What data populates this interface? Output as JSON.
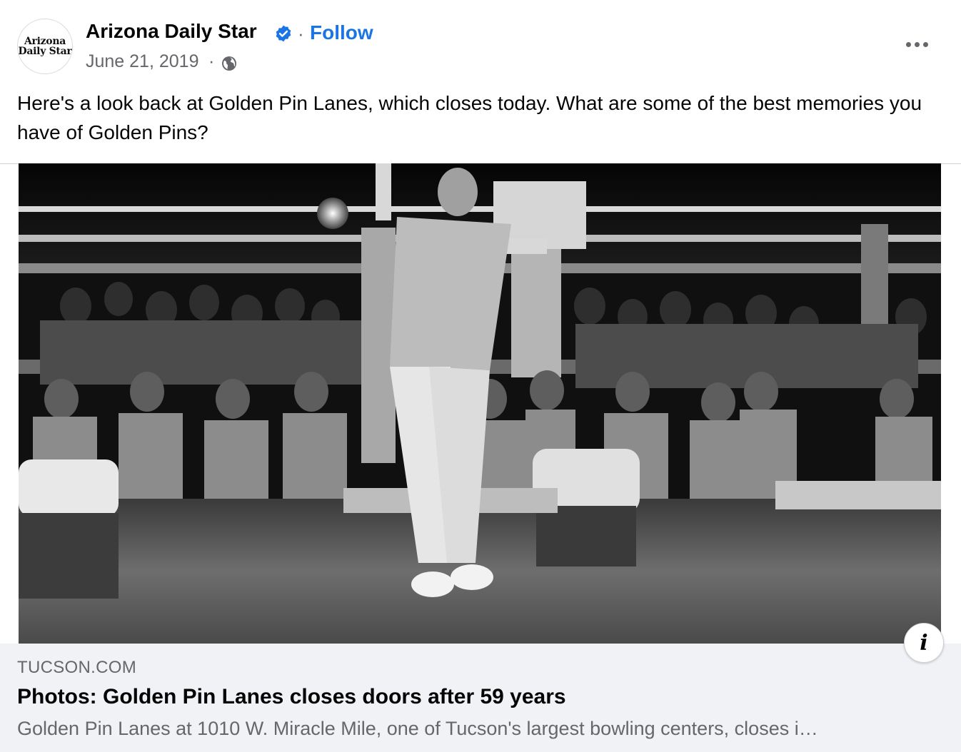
{
  "post": {
    "page_name": "Arizona Daily Star",
    "follow_label": "Follow",
    "separator": "·",
    "date": "June 21, 2019",
    "avatar": {
      "logo_line1": "Arizona",
      "logo_line2": "Daily Star"
    },
    "icons": {
      "verified": "verified-badge-icon",
      "audience": "globe-icon",
      "menu": "more-options-icon"
    },
    "message": "Here's a look back at Golden Pin Lanes, which closes today. What are some of the best memories you have of Golden Pins?"
  },
  "link_preview": {
    "domain": "TUCSON.COM",
    "title": "Photos: Golden Pin Lanes closes doors after 59 years",
    "description": "Golden Pin Lanes at 1010 W. Miracle Mile, one of Tucson's largest bowling centers, closes i…",
    "info_icon_glyph": "i"
  },
  "colors": {
    "link_blue": "#1b74e4",
    "secondary_text": "#65676b",
    "preview_background": "#f0f2f5"
  }
}
